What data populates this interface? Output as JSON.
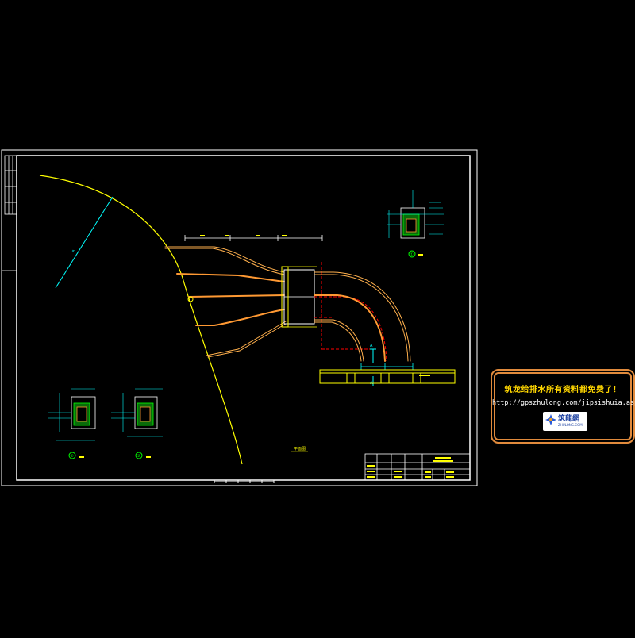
{
  "ad": {
    "title": "筑龙给排水所有资料都免费了！",
    "url": "http://gpszhulong.com/jipsishuia.asp",
    "logo_text": "筑龍網",
    "logo_subtext": "ZHULONG.COM"
  },
  "drawing": {
    "section_label_small": "①",
    "detail_labels": [
      "②",
      "③"
    ],
    "plan_label": "平面图",
    "colors": {
      "background": "#000000",
      "frame": "#ffffff",
      "arc": "#ffff00",
      "pipe": "#ff9933",
      "dimension": "#00ffff",
      "centerline": "#ff0000",
      "detail_green": "#00ff00"
    }
  }
}
